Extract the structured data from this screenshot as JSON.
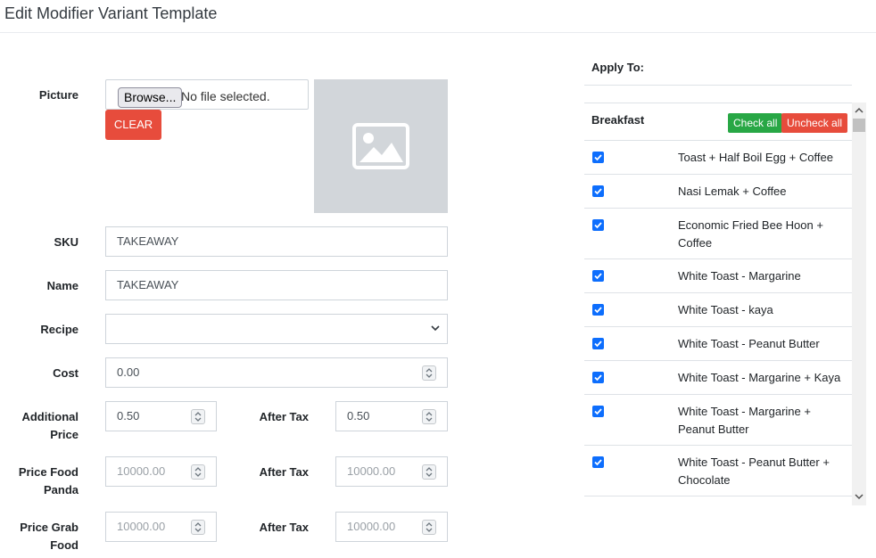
{
  "header": {
    "title": "Edit Modifier Variant Template"
  },
  "form": {
    "picture_label": "Picture",
    "browse_label": "Browse...",
    "file_status": "No file selected.",
    "clear_label": "CLEAR",
    "sku_label": "SKU",
    "sku_value": "TAKEAWAY",
    "name_label": "Name",
    "name_value": "TAKEAWAY",
    "recipe_label": "Recipe",
    "recipe_value": "",
    "cost_label": "Cost",
    "cost_value": "0.00",
    "additional_price_label_1": "Additional",
    "additional_price_label_2": "Price",
    "additional_price_value": "0.50",
    "additional_after_tax_label": "After Tax",
    "additional_after_tax_value": "0.50",
    "foodpanda_label_1": "Price Food",
    "foodpanda_label_2": "Panda",
    "foodpanda_placeholder": "10000.00",
    "foodpanda_after_tax_label": "After Tax",
    "foodpanda_after_tax_placeholder": "10000.00",
    "grab_label_1": "Price Grab",
    "grab_label_2": "Food",
    "grab_placeholder": "10000.00",
    "grab_after_tax_label": "After Tax",
    "grab_after_tax_placeholder": "10000.00"
  },
  "apply": {
    "title": "Apply To:",
    "group_title": "Breakfast",
    "check_all_label": "Check all",
    "uncheck_all_label": "Uncheck all",
    "items": [
      {
        "label": "Toast + Half Boil Egg + Coffee",
        "checked": true
      },
      {
        "label": "Nasi Lemak + Coffee",
        "checked": true
      },
      {
        "label": "Economic Fried Bee Hoon + Coffee",
        "checked": true
      },
      {
        "label": "White Toast - Margarine",
        "checked": true
      },
      {
        "label": "White Toast - kaya",
        "checked": true
      },
      {
        "label": "White Toast - Peanut Butter",
        "checked": true
      },
      {
        "label": "White Toast - Margarine + Kaya",
        "checked": true
      },
      {
        "label": "White Toast - Margarine + Peanut Butter",
        "checked": true
      },
      {
        "label": "White Toast - Peanut Butter + Chocolate",
        "checked": true
      }
    ]
  },
  "colors": {
    "danger": "#e74c3c",
    "success": "#28a745",
    "checkbox": "#0d6efd"
  }
}
